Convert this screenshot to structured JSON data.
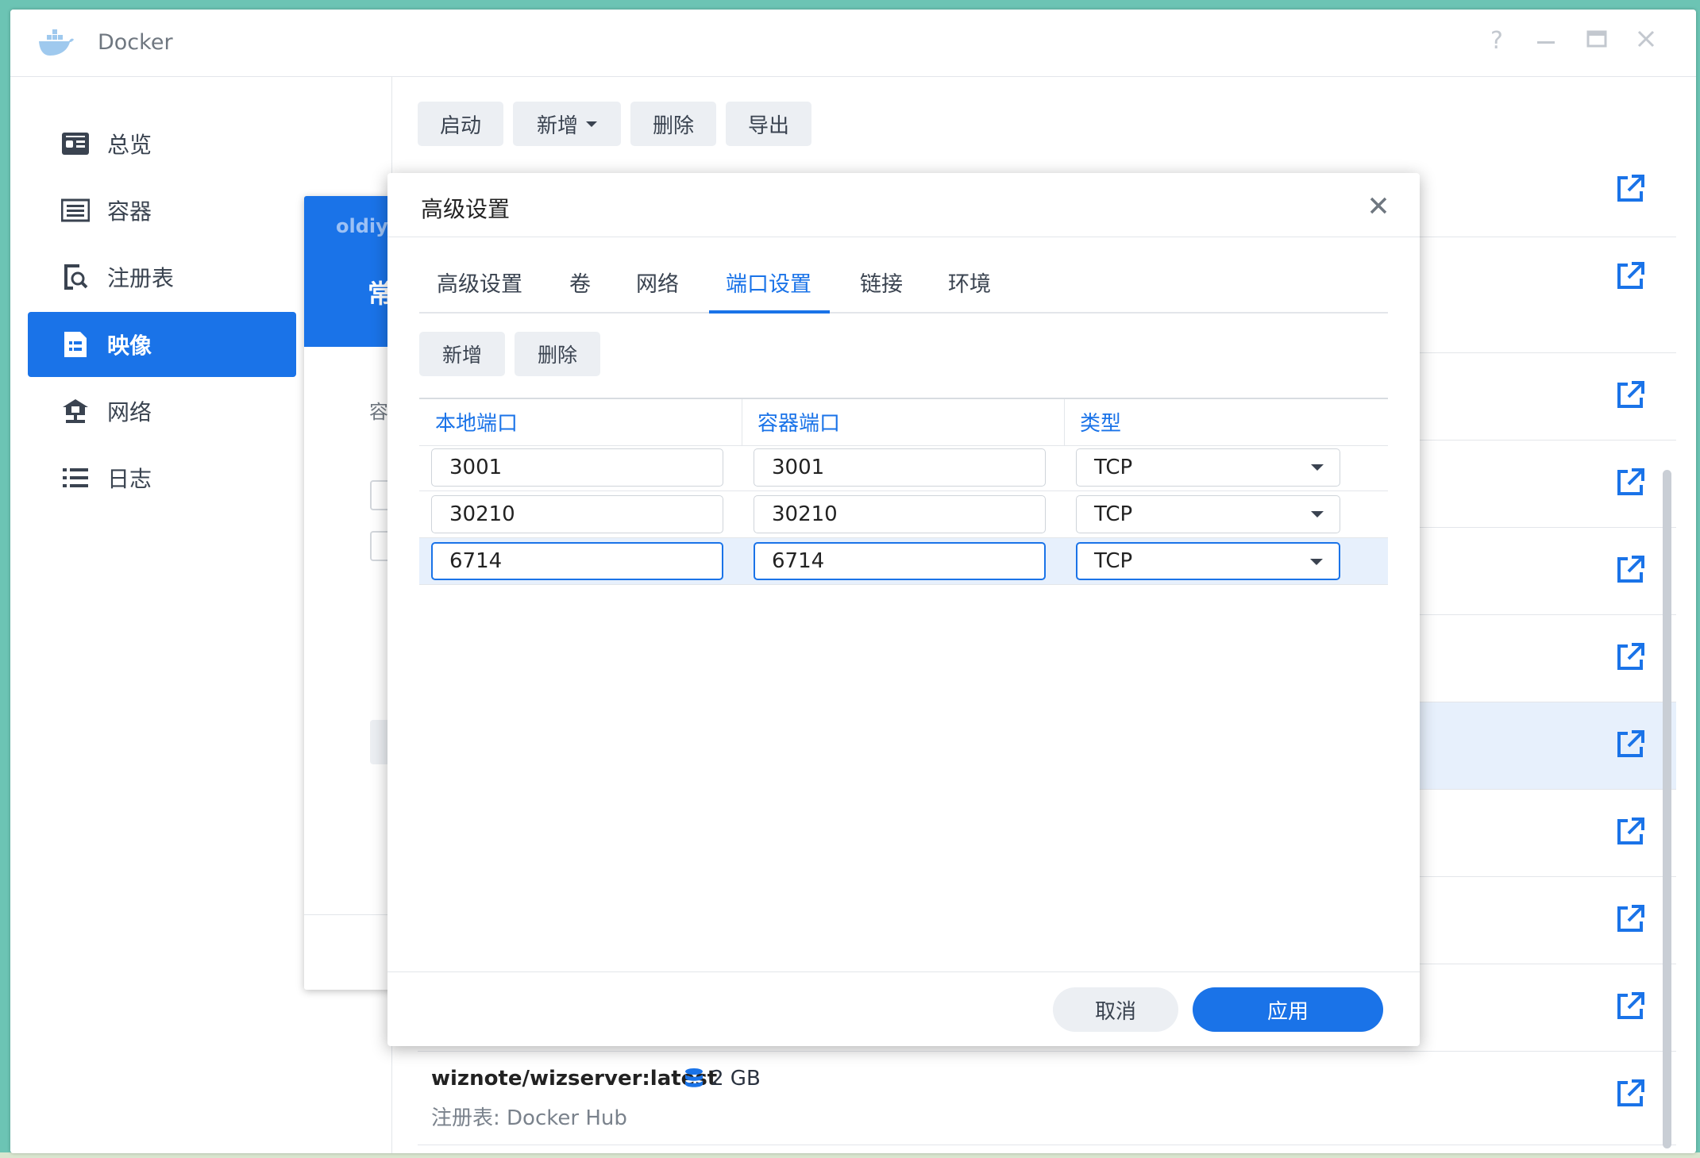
{
  "window": {
    "title": "Docker",
    "help": "?",
    "minimize": "—",
    "close": "✕"
  },
  "toolbar": {
    "start": "启动",
    "add": "新增",
    "delete": "删除",
    "export": "导出"
  },
  "sidebar": {
    "items": [
      {
        "label": "总览",
        "icon": "overview-icon"
      },
      {
        "label": "容器",
        "icon": "container-icon"
      },
      {
        "label": "注册表",
        "icon": "registry-icon"
      },
      {
        "label": "映像",
        "icon": "image-icon",
        "active": true
      },
      {
        "label": "网络",
        "icon": "network-icon"
      },
      {
        "label": "日志",
        "icon": "log-icon"
      }
    ]
  },
  "image_list": {
    "last_item": {
      "name": "wiznote/wizserver:latest",
      "size": "2 GB",
      "registry": "注册表: Docker Hub"
    }
  },
  "wizard": {
    "subtitle": "oldiy",
    "title_partial": "常",
    "label_partial": "容"
  },
  "modal": {
    "title": "高级设置",
    "close": "✕",
    "tabs": [
      "高级设置",
      "卷",
      "网络",
      "端口设置",
      "链接",
      "环境"
    ],
    "active_tab": "端口设置",
    "add": "新增",
    "delete": "删除",
    "columns": [
      "本地端口",
      "容器端口",
      "类型"
    ],
    "rows": [
      {
        "local": "3001",
        "container": "3001",
        "type": "TCP"
      },
      {
        "local": "30210",
        "container": "30210",
        "type": "TCP"
      },
      {
        "local": "6714",
        "container": "6714",
        "type": "TCP",
        "selected": true
      }
    ],
    "cancel": "取消",
    "apply": "应用"
  },
  "colors": {
    "accent": "#1a73e8",
    "highlight": "#e7f0fc",
    "button_bg": "#eceff3"
  }
}
